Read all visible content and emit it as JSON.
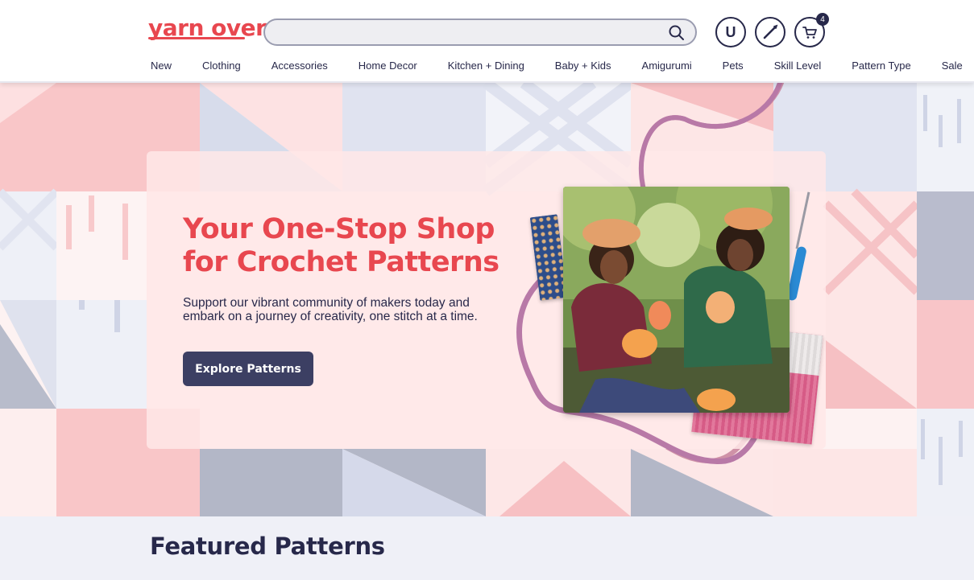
{
  "brand": {
    "logo_text": "yarn over",
    "accent": "#e8474f",
    "navy": "#27284a"
  },
  "header": {
    "search_placeholder": "",
    "account_initial": "U",
    "cart_count": "4",
    "icons": [
      "search-icon",
      "user-icon",
      "crochet-hook-icon",
      "cart-icon"
    ]
  },
  "nav": {
    "items": [
      "New",
      "Clothing",
      "Accessories",
      "Home Decor",
      "Kitchen + Dining",
      "Baby + Kids",
      "Amigurumi",
      "Pets",
      "Skill Level",
      "Pattern Type",
      "Sale"
    ]
  },
  "hero": {
    "title_line1": "Your One-Stop Shop",
    "title_line2": "for Crochet Patterns",
    "subtitle": "Support our vibrant community of makers today and embark on a journey of creativity, one stitch at a time.",
    "cta_label": "Explore Patterns"
  },
  "featured": {
    "title": "Featured Patterns"
  }
}
